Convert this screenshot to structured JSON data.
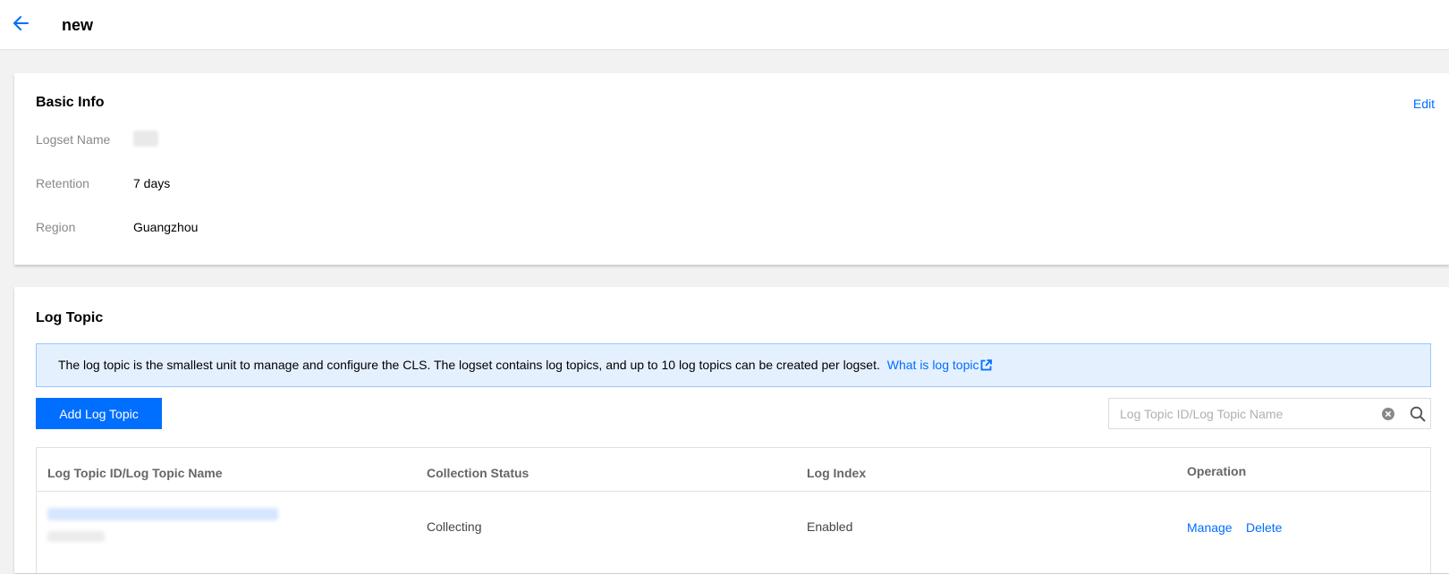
{
  "header": {
    "title": "new",
    "back_icon": "arrow-left-icon"
  },
  "basic_info": {
    "title": "Basic Info",
    "edit_label": "Edit",
    "rows": [
      {
        "label": "Logset Name",
        "value": ""
      },
      {
        "label": "Retention",
        "value": "7 days"
      },
      {
        "label": "Region",
        "value": "Guangzhou"
      }
    ]
  },
  "log_topic": {
    "title": "Log Topic",
    "notice_text": "The log topic is the smallest unit to manage and configure the CLS. The logset contains log topics, and up to 10 log topics can be created per logset.",
    "notice_link": "What is log topic",
    "add_button": "Add Log Topic",
    "search_placeholder": "Log Topic ID/Log Topic Name",
    "columns": [
      "Log Topic ID/Log Topic Name",
      "Collection Status",
      "Log Index",
      "Operation"
    ],
    "rows": [
      {
        "id_name": "",
        "status": "Collecting",
        "index": "Enabled",
        "ops": [
          "Manage",
          "Delete"
        ]
      }
    ]
  },
  "colors": {
    "accent": "#006eff",
    "notice_bg": "#e5f0ff",
    "notice_border": "#97c7ff",
    "page_bg": "#f2f2f2"
  }
}
